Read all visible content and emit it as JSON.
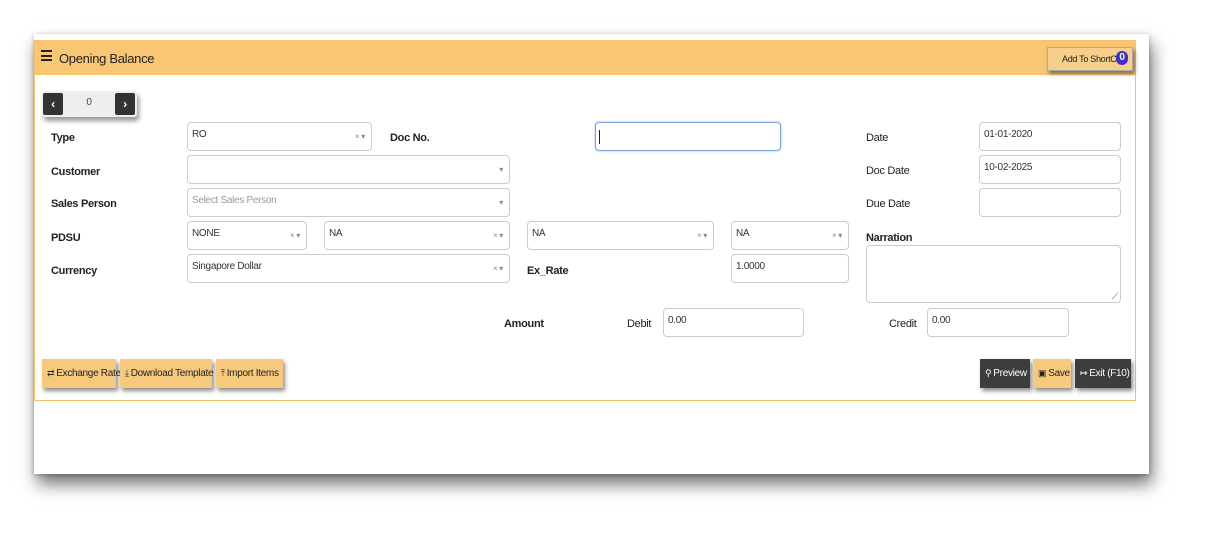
{
  "header": {
    "title": "Opening Balance",
    "shortcut_label": "Add To ShortCut",
    "shortcut_count": "0"
  },
  "nav": {
    "prev": "‹",
    "next": "›",
    "counter": "0"
  },
  "form": {
    "type": {
      "label": "Type",
      "value": "RO"
    },
    "doc_no": {
      "label": "Doc No.",
      "value": ""
    },
    "date": {
      "label": "Date",
      "value": "01-01-2020"
    },
    "customer": {
      "label": "Customer",
      "value": ""
    },
    "doc_date": {
      "label": "Doc Date",
      "value": "10-02-2025"
    },
    "sales_person": {
      "label": "Sales Person",
      "placeholder": "Select Sales Person"
    },
    "due_date": {
      "label": "Due Date",
      "value": ""
    },
    "pdsu": {
      "label": "PDSU",
      "values": [
        "NONE",
        "NA",
        "NA",
        "NA"
      ]
    },
    "narration": {
      "label": "Narration",
      "value": ""
    },
    "currency": {
      "label": "Currency",
      "value": "Singapore Dollar"
    },
    "ex_rate": {
      "label": "Ex_Rate",
      "value": "1.0000"
    },
    "amount_label": "Amount",
    "debit": {
      "label": "Debit",
      "value": "0.00"
    },
    "credit": {
      "label": "Credit",
      "value": "0.00"
    }
  },
  "buttons": {
    "exchange_rate": "Exchange Rate",
    "download_template": "Download Template",
    "import_items": "Import Items",
    "preview": "Preview",
    "save": "Save",
    "exit": "Exit (F10)"
  },
  "icons": {
    "menu": "hamburger-icon",
    "exchange": "exchange-icon",
    "download": "download-icon",
    "import": "upload-icon",
    "preview": "search-icon",
    "save": "floppy-disk-icon",
    "exit": "sign-out-icon"
  },
  "colors": {
    "header_bg": "#f9c774",
    "panel_border": "#f4c26b",
    "orange_button": "#f6c97d",
    "dark_button": "#3d3d3d",
    "badge": "#3b2fd0",
    "focus_border": "#7aa7d6"
  }
}
